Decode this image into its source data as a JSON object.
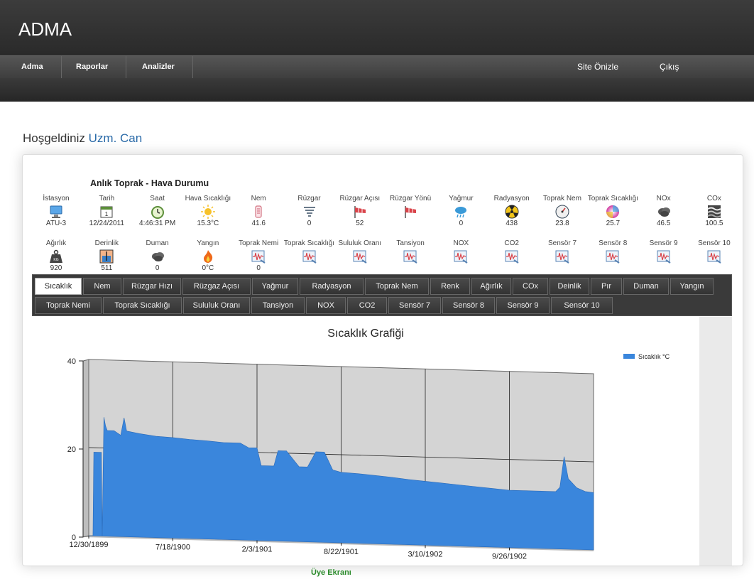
{
  "app": {
    "title": "ADMA"
  },
  "nav": {
    "items": [
      {
        "label": "Adma"
      },
      {
        "label": "Raporlar"
      },
      {
        "label": "Analizler"
      }
    ],
    "right": [
      {
        "label": "Site Önizle"
      },
      {
        "label": "Çıkış"
      }
    ]
  },
  "welcome": {
    "greeting": "Hoşgeldiniz",
    "user": "Uzm. Can"
  },
  "panel": {
    "title": "Anlık Toprak - Hava Durumu"
  },
  "sensors_row1": [
    {
      "label": "İstasyon",
      "value": "ATU-3",
      "icon": "computer-icon"
    },
    {
      "label": "Tarih",
      "value": "12/24/2011",
      "icon": "calendar-icon"
    },
    {
      "label": "Saat",
      "value": "4:46:31 PM",
      "icon": "clock-icon"
    },
    {
      "label": "Hava Sıcaklığı",
      "value": "15.3°C",
      "icon": "sun-icon"
    },
    {
      "label": "Nem",
      "value": "41.6",
      "icon": "humidity-icon"
    },
    {
      "label": "Rüzgar",
      "value": "0",
      "icon": "tornado-icon"
    },
    {
      "label": "Rüzgar Açısı",
      "value": "52",
      "icon": "windsock-icon"
    },
    {
      "label": "Rüzgar Yönü",
      "value": "",
      "icon": "windsock-icon"
    },
    {
      "label": "Yağmur",
      "value": "0",
      "icon": "rain-cloud-icon"
    },
    {
      "label": "Radyasyon",
      "value": "438",
      "icon": "radiation-icon"
    },
    {
      "label": "Toprak Nem",
      "value": "23.8",
      "icon": "gauge-icon"
    },
    {
      "label": "Toprak Sıcaklığı",
      "value": "25.7",
      "icon": "color-wheel-icon"
    },
    {
      "label": "NOx",
      "value": "46.5",
      "icon": "smoke-cloud-icon"
    },
    {
      "label": "COx",
      "value": "100.5",
      "icon": "waves-icon"
    }
  ],
  "sensors_row2": [
    {
      "label": "Ağırlık",
      "value": "920",
      "icon": "weight-icon"
    },
    {
      "label": "Derinlik",
      "value": "511",
      "icon": "depth-icon"
    },
    {
      "label": "Duman",
      "value": "0",
      "icon": "smoke-cloud-icon"
    },
    {
      "label": "Yangın",
      "value": "0°C",
      "icon": "fire-icon"
    },
    {
      "label": "Toprak Nemi",
      "value": "0",
      "icon": "signal-chart-icon"
    },
    {
      "label": "Toprak Sıcaklığı",
      "value": "",
      "icon": "signal-chart-icon"
    },
    {
      "label": "Sululuk Oranı",
      "value": "",
      "icon": "signal-chart-icon"
    },
    {
      "label": "Tansiyon",
      "value": "",
      "icon": "signal-chart-icon"
    },
    {
      "label": "NOX",
      "value": "",
      "icon": "signal-chart-icon"
    },
    {
      "label": "CO2",
      "value": "",
      "icon": "signal-chart-icon"
    },
    {
      "label": "Sensör 7",
      "value": "",
      "icon": "signal-chart-icon"
    },
    {
      "label": "Sensör 8",
      "value": "",
      "icon": "signal-chart-icon"
    },
    {
      "label": "Sensör 9",
      "value": "",
      "icon": "signal-chart-icon"
    },
    {
      "label": "Sensör 10",
      "value": "",
      "icon": "signal-chart-icon"
    }
  ],
  "tabs_row1": [
    "Sıcaklık",
    "Nem",
    "Rüzgar Hızı",
    "Rüzgaz Açısı",
    "Yağmur",
    "Radyasyon",
    "Toprak Nem",
    "Renk",
    "Ağırlık",
    "COx",
    "Deinlik",
    "Pır",
    "Duman",
    "Yangın"
  ],
  "tabs_row2": [
    "Toprak Nemi",
    "Toprak Sıcaklığı",
    "Sululuk Oranı",
    "Tansiyon",
    "NOX",
    "CO2",
    "Sensör 7",
    "Sensör 8",
    "Sensör 9",
    "Sensör 10"
  ],
  "active_tab": "Sıcaklık",
  "chart_data": {
    "type": "area",
    "title": "Sıcaklık Grafiği",
    "xlabel": "",
    "ylabel": "",
    "ylim": [
      0,
      40
    ],
    "yticks": [
      0,
      20,
      40
    ],
    "xtick_labels": [
      "12/30/1899",
      "7/18/1900",
      "2/3/1901",
      "8/22/1901",
      "3/10/1902",
      "9/26/1902"
    ],
    "xlim": [
      0,
      6
    ],
    "grid": true,
    "legend_position": "top-right",
    "series": [
      {
        "name": "Sıcaklık °C",
        "color": "#3a86dc",
        "x": [
          0.0,
          0.05,
          0.06,
          0.15,
          0.16,
          0.18,
          0.2,
          0.22,
          0.3,
          0.38,
          0.42,
          0.45,
          0.6,
          0.8,
          1.0,
          1.2,
          1.4,
          1.6,
          1.8,
          1.9,
          2.0,
          2.05,
          2.2,
          2.25,
          2.35,
          2.5,
          2.6,
          2.7,
          2.8,
          2.9,
          3.0,
          3.2,
          3.4,
          3.6,
          3.8,
          4.0,
          4.2,
          4.4,
          4.6,
          4.8,
          5.0,
          5.2,
          5.3,
          5.4,
          5.55,
          5.6,
          5.65,
          5.7,
          5.8,
          5.9,
          6.0
        ],
        "y": [
          0,
          0,
          19,
          19,
          0,
          27,
          25,
          24,
          24,
          23,
          27,
          24,
          23.5,
          23,
          22.8,
          22.5,
          22.3,
          22,
          22,
          21,
          21,
          17,
          17,
          20.5,
          20.5,
          17,
          17,
          20.5,
          20.5,
          16.5,
          16,
          15.8,
          15.5,
          15.2,
          14.8,
          14.5,
          14.2,
          13.9,
          13.6,
          13.3,
          13.0,
          13.0,
          13.0,
          13.0,
          13.0,
          14,
          21,
          16,
          14,
          13.2,
          13
        ]
      }
    ]
  },
  "footer": {
    "label": "Üye Ekranı"
  }
}
